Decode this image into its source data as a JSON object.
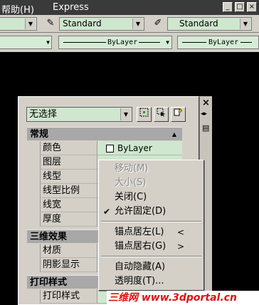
{
  "menubar": {
    "items": [
      "帮助(H)",
      "Express"
    ],
    "window_buttons": [
      "_",
      "□",
      "×"
    ]
  },
  "toolbar1": {
    "text_style": "Standard",
    "dim_style": "Standard"
  },
  "toolbar2": {
    "linetype": "ByLayer",
    "lineweight": "ByLayer"
  },
  "palette": {
    "selection": "无选择",
    "strip_buttons": [
      "×",
      "◂▸",
      "▤"
    ],
    "categories": [
      {
        "title": "常规",
        "rows": [
          {
            "label": "颜色",
            "value": "ByLayer"
          },
          {
            "label": "图层",
            "value": ""
          },
          {
            "label": "线型",
            "value": ""
          },
          {
            "label": "线型比例",
            "value": ""
          },
          {
            "label": "线宽",
            "value": ""
          },
          {
            "label": "厚度",
            "value": ""
          }
        ]
      },
      {
        "title": "三维效果",
        "rows": [
          {
            "label": "材质",
            "value": ""
          },
          {
            "label": "阴影显示",
            "value": ""
          }
        ]
      },
      {
        "title": "打印样式",
        "rows": [
          {
            "label": "打印样式",
            "value": ""
          }
        ]
      }
    ]
  },
  "context_menu": {
    "items": [
      {
        "label": "移动(M)",
        "disabled": true
      },
      {
        "label": "大小(S)",
        "disabled": true
      },
      {
        "label": "关闭(C)",
        "disabled": false
      },
      {
        "label": "允许固定(D)",
        "disabled": false,
        "checked": true
      },
      {
        "label": "锚点居左(L)",
        "disabled": false,
        "submenu": "<"
      },
      {
        "label": "锚点居右(G)",
        "disabled": false,
        "submenu": ">"
      },
      {
        "label": "自动隐藏(A)",
        "disabled": false
      },
      {
        "label": "透明度(T)...",
        "disabled": false
      }
    ]
  },
  "watermark": "三维网 www.3dportal.cn"
}
